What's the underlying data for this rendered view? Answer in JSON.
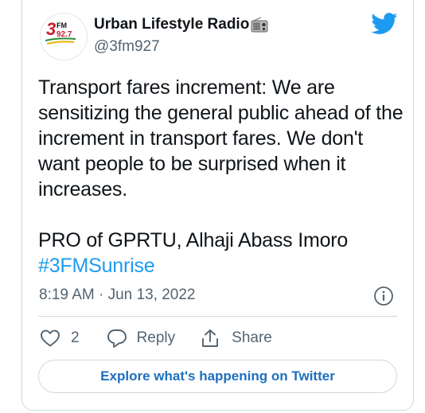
{
  "account": {
    "display_name": "Urban Lifestyle Radio",
    "handle": "@3fm927",
    "avatar_logo_text": "3FM 92.7"
  },
  "tweet": {
    "paragraph_1": "Transport fares increment: We are sensitizing the general public ahead of the increment in transport fares. We don't want people to be surprised when it increases.",
    "paragraph_2": "PRO of GPRTU, Alhaji Abass Imoro",
    "hashtag": "#3FMSunrise",
    "timestamp": "8:19 AM · Jun 13, 2022"
  },
  "actions": {
    "like_count": "2",
    "reply_label": "Reply",
    "share_label": "Share"
  },
  "explore_button": "Explore what's happening on Twitter",
  "colors": {
    "twitter_blue": "#1d9bf0",
    "text_primary": "#0f1419",
    "text_secondary": "#536471",
    "border": "#cfd9de"
  },
  "icons": [
    "radio-icon",
    "twitter-logo-icon",
    "info-icon",
    "heart-icon",
    "reply-icon",
    "share-icon"
  ]
}
